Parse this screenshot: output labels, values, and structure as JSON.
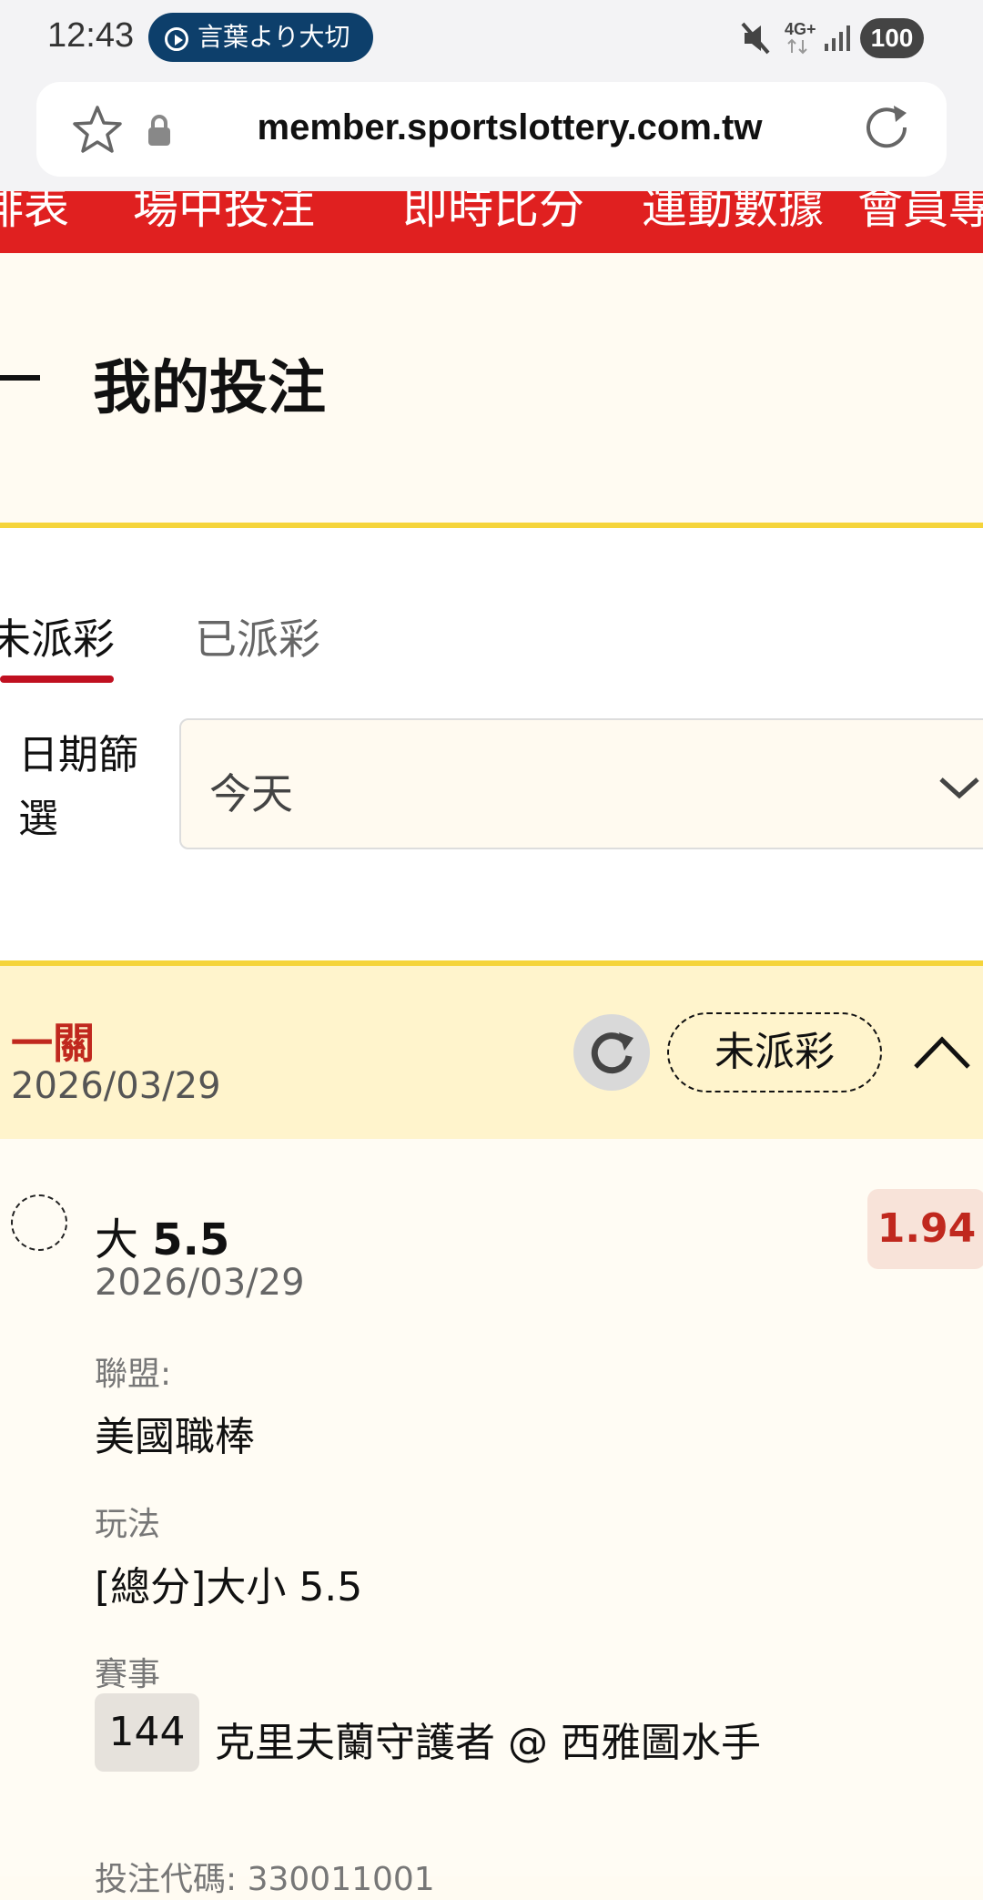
{
  "status_bar": {
    "time": "12:43",
    "media_text": "言葉より大切",
    "battery": "100",
    "network": "4G+"
  },
  "browser": {
    "url": "member.sportslottery.com.tw"
  },
  "nav": {
    "items": [
      "排表",
      "場中投注",
      "即時比分",
      "運動數據",
      "會員專"
    ]
  },
  "page": {
    "title": "我的投注"
  },
  "tabs": {
    "unsettled": "未派彩",
    "settled": "已派彩"
  },
  "filter": {
    "label": "日期篩選",
    "value": "今天"
  },
  "bet": {
    "type": "一關",
    "date": "2026/03/29",
    "status": "未派彩",
    "selection_prefix": "大",
    "selection_value": "5.5",
    "selection_date": "2026/03/29",
    "odds": "1.94",
    "league_label": "聯盟:",
    "league": "美國職棒",
    "market_label": "玩法",
    "market": "[總分]大小 5.5",
    "event_label": "賽事",
    "game_number": "144",
    "game_name": "克里夫蘭守護者 @ 西雅圖水手",
    "code_partial": "投注代碼: 330011001"
  }
}
